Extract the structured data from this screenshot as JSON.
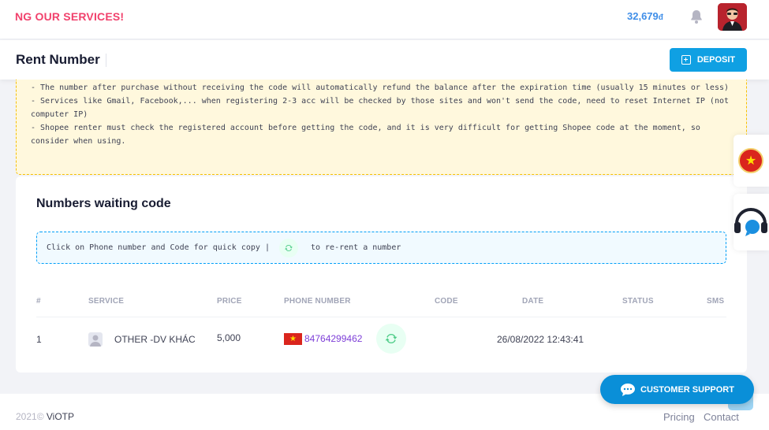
{
  "topbar": {
    "marquee": "NG OUR SERVICES!",
    "balance": "32,679",
    "currency": "đ",
    "icons": [
      "bell-icon",
      "user-avatar"
    ]
  },
  "subheader": {
    "title": "Rent Number",
    "deposit_label": "DEPOSIT"
  },
  "notice": {
    "lines": [
      "- The number after purchase without receiving the code will automatically refund the balance after the expiration time (usually 15 minutes or less)",
      "- Services like Gmail, Facebook,... when registering 2-3 acc will be checked by those sites and won't send the code, need to reset Internet IP (not computer IP)",
      "- Shopee renter must check the registered account before getting the code, and it is very difficult for getting Shopee code at the moment, so consider when using."
    ]
  },
  "waiting": {
    "title": "Numbers waiting code",
    "info_before": "Click on Phone number and Code for quick copy |",
    "info_after": "to re-rent a number",
    "columns": [
      "#",
      "SERVICE",
      "PRICE",
      "PHONE NUMBER",
      "CODE",
      "DATE",
      "STATUS",
      "SMS"
    ],
    "rows": [
      {
        "index": "1",
        "service": "OTHER -DV KHÁC",
        "price": "5,000",
        "phone": "84764299462",
        "code": "",
        "date": "26/08/2022 12:43:41",
        "status": "",
        "sms": ""
      }
    ]
  },
  "footer": {
    "year": "2021©",
    "brand": "ViOTP",
    "links": [
      "Pricing",
      "Contact"
    ]
  },
  "support_label": "CUSTOMER SUPPORT",
  "colors": {
    "accent": "#0fa0e3",
    "marquee": "#f1416c",
    "notice_bg": "#fff8dd",
    "phone": "#7e3fd8",
    "refresh": "#50cd89"
  }
}
